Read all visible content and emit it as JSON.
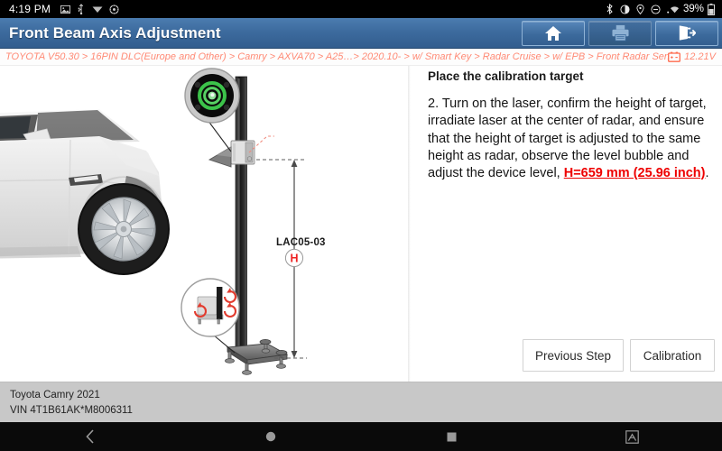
{
  "statusbar": {
    "time": "4:19 PM",
    "left_icons": [
      "image-icon",
      "usb-icon",
      "vpn-icon",
      "settings-icon"
    ],
    "right_icons": [
      "bluetooth-icon",
      "brightness-icon",
      "location-icon",
      "do-not-disturb-icon",
      "wifi-icon"
    ],
    "battery_percent": "39%",
    "battery_icon": "battery-icon"
  },
  "titlebar": {
    "title": "Front Beam Axis Adjustment",
    "buttons": [
      {
        "name": "home-button",
        "icon": "home-icon",
        "enabled": true
      },
      {
        "name": "print-button",
        "icon": "printer-icon",
        "enabled": false
      },
      {
        "name": "exit-button",
        "icon": "exit-icon",
        "enabled": true
      }
    ]
  },
  "breadcrumb": {
    "path": "TOYOTA V50.30 > 16PIN DLC(Europe and Other) > Camry > AXVA70 > A25…> 2020.10- > w/ Smart Key > Radar Cruise > w/ EPB > Front Radar Sensor",
    "battery_icon": "vehicle-battery-icon",
    "voltage": "12.21V"
  },
  "illustration": {
    "device_label": "LAC05-03",
    "dimension_label": "H",
    "parts": [
      "vehicle-photo",
      "laser-level-pole",
      "bubble-level-detail",
      "base-adjuster-detail",
      "height-dimension-line"
    ]
  },
  "panel": {
    "title": "Place the calibration target",
    "body_before": "2. Turn on the laser, confirm the height of target, irradiate laser at the center of radar, and ensure that the height of target is adjusted to the same height as radar, observe the level bubble and adjust the device level, ",
    "highlight": "H=659 mm (25.96 inch)",
    "body_after": "."
  },
  "actions": {
    "previous_label": "Previous Step",
    "calibration_label": "Calibration"
  },
  "footer": {
    "vehicle": "Toyota Camry 2021",
    "vin": "VIN 4T1B61AK*M8006311"
  },
  "navbar": {
    "items": [
      {
        "name": "nav-back-button",
        "icon": "chevron-left-icon"
      },
      {
        "name": "nav-home-button",
        "icon": "circle-icon"
      },
      {
        "name": "nav-recents-button",
        "icon": "square-icon"
      },
      {
        "name": "nav-screenshot-button",
        "icon": "screenshot-icon"
      }
    ]
  },
  "colors": {
    "title_blue": "#3d6b9e",
    "breadcrumb_orange": "#ff8a75",
    "highlight_red": "#ee0000",
    "footer_gray": "#c8c8c8"
  }
}
